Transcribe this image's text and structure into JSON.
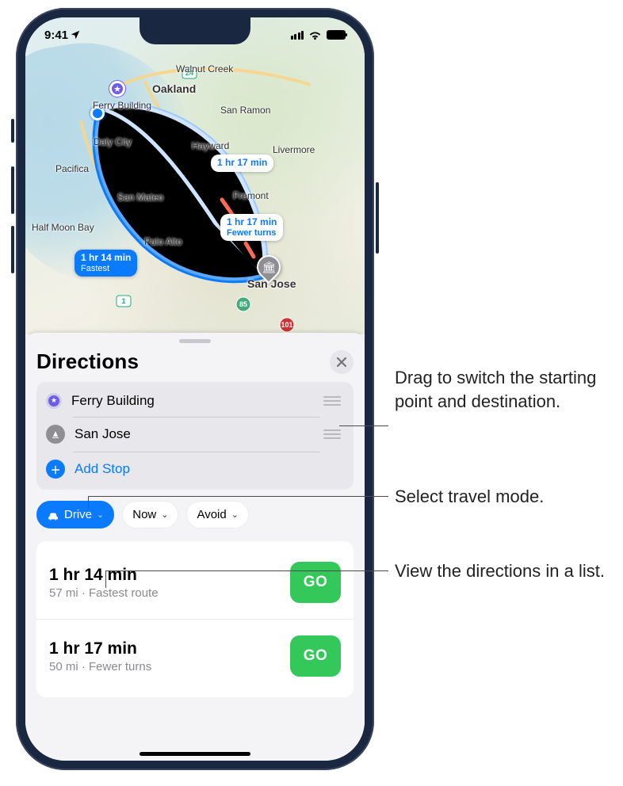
{
  "statusBar": {
    "time": "9:41"
  },
  "map": {
    "cities": {
      "oakland": "Oakland",
      "walnutCreek": "Walnut Creek",
      "sanRamon": "San Ramon",
      "hayward": "Hayward",
      "livermore": "Livermore",
      "dalyCity": "Daly City",
      "pacifica": "Pacifica",
      "sanMateo": "San Mateo",
      "halfMoonBay": "Half Moon Bay",
      "paloAlto": "Palo Alto",
      "fremont": "Fremont",
      "sanJose": "San Jose",
      "ferryBuilding": "Ferry Building"
    },
    "routePills": {
      "alt1": {
        "time": "1 hr 17 min"
      },
      "alt2": {
        "time": "1 hr 17 min",
        "note": "Fewer turns"
      },
      "primary": {
        "time": "1 hr 14 min",
        "note": "Fastest"
      }
    }
  },
  "sheet": {
    "title": "Directions",
    "stops": {
      "origin": "Ferry Building",
      "destination": "San Jose",
      "addStop": "Add Stop"
    },
    "chips": {
      "drive": "Drive",
      "now": "Now",
      "avoid": "Avoid"
    },
    "routes": [
      {
        "time": "1 hr 14 min",
        "sub": "57 mi · Fastest route",
        "go": "GO"
      },
      {
        "time": "1 hr 17 min",
        "sub": "50 mi · Fewer turns",
        "go": "GO"
      }
    ]
  },
  "annotations": {
    "drag": "Drag to switch the starting point and destination.",
    "mode": "Select travel mode.",
    "list": "View the directions in a list."
  }
}
